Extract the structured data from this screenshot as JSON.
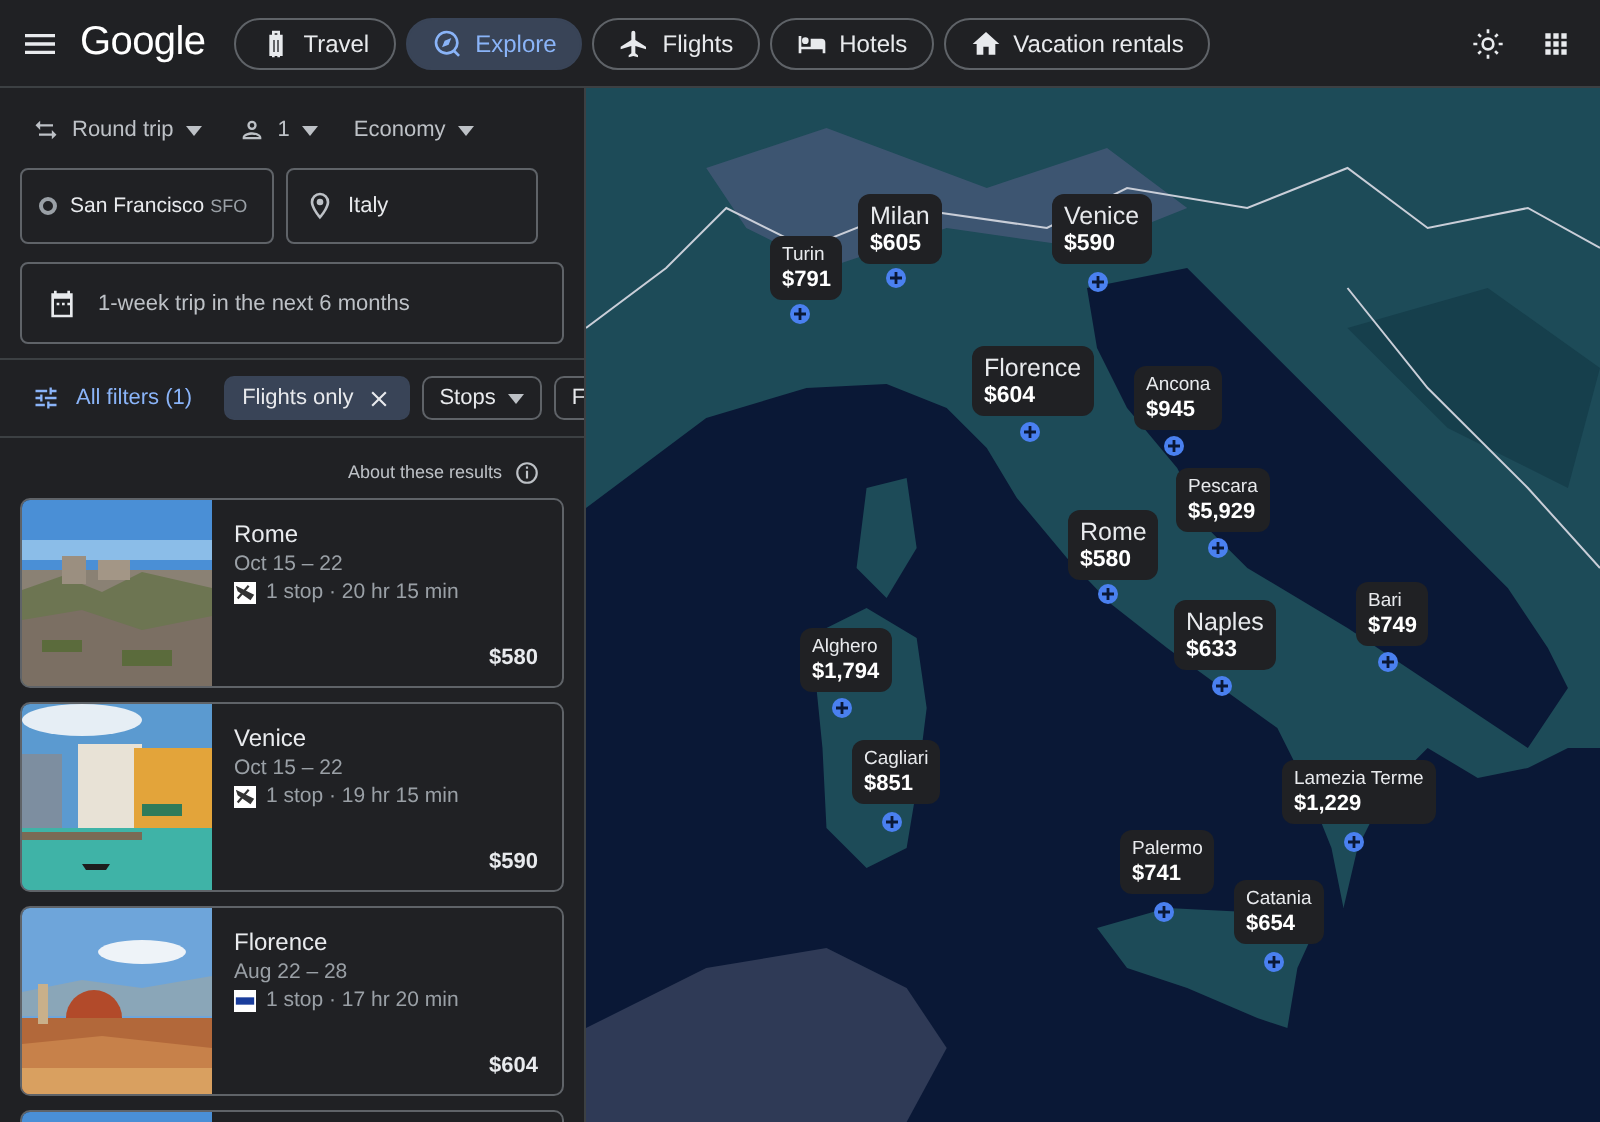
{
  "header": {
    "logo": "Google",
    "tabs": [
      {
        "label": "Travel",
        "selected": false
      },
      {
        "label": "Explore",
        "selected": true
      },
      {
        "label": "Flights",
        "selected": false
      },
      {
        "label": "Hotels",
        "selected": false
      },
      {
        "label": "Vacation rentals",
        "selected": false
      }
    ]
  },
  "search": {
    "trip_type": "Round trip",
    "passengers": "1",
    "cabin": "Economy",
    "origin": {
      "value": "San Francisco",
      "code": "SFO"
    },
    "destination": {
      "value": "Italy"
    },
    "dates": "1-week trip in the next 6 months"
  },
  "filters": {
    "all_filters": "All filters (1)",
    "chips": [
      {
        "label": "Flights only",
        "kind": "remove",
        "selected": true
      },
      {
        "label": "Stops",
        "kind": "dropdown",
        "selected": false
      },
      {
        "label": "F",
        "kind": "cut",
        "selected": false
      }
    ]
  },
  "results_note": "About these results",
  "results": [
    {
      "kind": "card",
      "destination": "Rome",
      "dates": "Oct 15 – 22",
      "details": "1 stop · 20 hr 15 min",
      "price": "$580"
    },
    {
      "kind": "card",
      "destination": "Venice",
      "dates": "Oct 15 – 22",
      "details": "1 stop · 19 hr 15 min",
      "price": "$590"
    },
    {
      "kind": "card",
      "destination": "Florence",
      "dates": "Aug 22 – 28",
      "details": "1 stop · 17 hr 20 min",
      "price": "$604"
    },
    {
      "kind": "partial"
    }
  ],
  "map": {
    "markers": [
      {
        "city": "Turin",
        "price": "$791",
        "kind": "small"
      },
      {
        "city": "Milan",
        "price": "$605",
        "kind": "large"
      },
      {
        "city": "Venice",
        "price": "$590",
        "kind": "large"
      },
      {
        "city": "Florence",
        "price": "$604",
        "kind": "large"
      },
      {
        "city": "Ancona",
        "price": "$945",
        "kind": "small"
      },
      {
        "city": "Pescara",
        "price": "$5,929",
        "kind": "small"
      },
      {
        "city": "Rome",
        "price": "$580",
        "kind": "large"
      },
      {
        "city": "Naples",
        "price": "$633",
        "kind": "large"
      },
      {
        "city": "Bari",
        "price": "$749",
        "kind": "small"
      },
      {
        "city": "Alghero",
        "price": "$1,794",
        "kind": "small"
      },
      {
        "city": "Cagliari",
        "price": "$851",
        "kind": "small"
      },
      {
        "city": "Lamezia Terme",
        "price": "$1,229",
        "kind": "small"
      },
      {
        "city": "Palermo",
        "price": "$741",
        "kind": "small"
      },
      {
        "city": "Catania",
        "price": "$654",
        "kind": "small"
      }
    ]
  }
}
